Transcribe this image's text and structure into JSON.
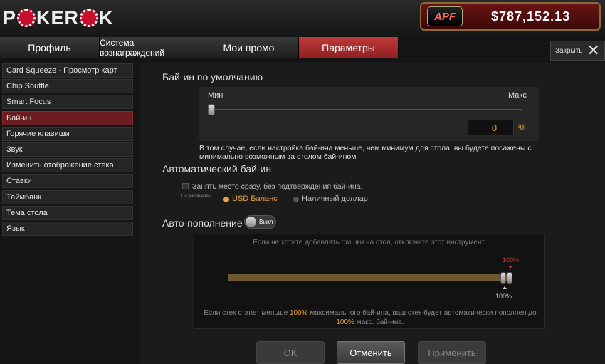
{
  "header": {
    "logo_left": "P",
    "logo_mid": "KER",
    "logo_right": "K",
    "apf_badge": "APF",
    "balance": "$787,152.13"
  },
  "tabs": [
    {
      "label": "Профиль"
    },
    {
      "label": "Система вознаграждений"
    },
    {
      "label": "Мои промо"
    },
    {
      "label": "Параметры"
    }
  ],
  "close": {
    "label": "Закрыть"
  },
  "sidebar": {
    "items": [
      {
        "label": "Card Squeeze - Просмотр карт"
      },
      {
        "label": "Chip Shuffle"
      },
      {
        "label": "Smart Focus"
      },
      {
        "label": "Бай-ин"
      },
      {
        "label": "Горячие клавиши"
      },
      {
        "label": "Звук"
      },
      {
        "label": "Изменить отображение стека"
      },
      {
        "label": "Ставки"
      },
      {
        "label": "Таймбанк"
      },
      {
        "label": "Тема стола"
      },
      {
        "label": "Язык"
      }
    ]
  },
  "buyin": {
    "title": "Бай-ин по умолчанию",
    "min_label": "Мин",
    "max_label": "Макс",
    "value": "0",
    "unit": "%",
    "slider_fraction": 0,
    "note": "В том случае, если настройка бай-ина меньше, чем минимум для стола, вы будете посажены с минимально возможным за столом бай-ином"
  },
  "auto_buyin": {
    "title": "Автоматический бай-ин",
    "take_seat_label": "Занять место сразу, без подтверждения бай-ина.",
    "default_label": "По умолчанию",
    "option_usd": "USD Баланс",
    "option_cash": "Наличный доллар",
    "selected": "USD Баланс"
  },
  "auto_refill": {
    "title": "Авто-пополнение",
    "toggle_label": "Выкл",
    "hint": "Если не хотите добавлять фишки на стол, отключите этот инструмент.",
    "upper_value": "100%",
    "lower_value": "100%",
    "info_1": "Если стек станет меньше ",
    "info_pct_1": "100%",
    "info_2": " максимального бай-ина, ваш стек будет автоматически пополнен до ",
    "info_pct_2": "100%",
    "info_3": " макс. бай-ина."
  },
  "buttons": {
    "ok": "OK",
    "cancel": "Отменить",
    "apply": "Применить"
  },
  "colors": {
    "accent": "#e8a23a",
    "active_tab": "#b03033",
    "active_sidebar": "#6b1d1f"
  }
}
